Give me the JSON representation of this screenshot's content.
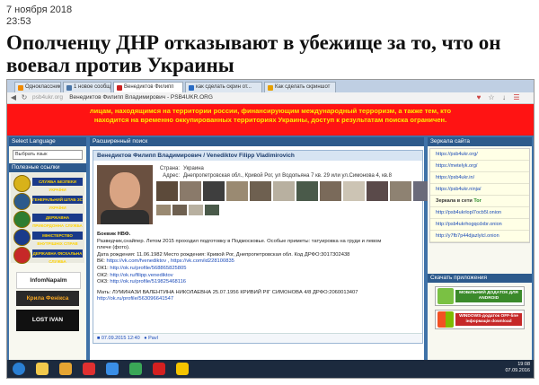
{
  "article": {
    "date": "7 ноября 2018",
    "time": "23:53",
    "headline": "Ополченцу ДНР отказывают в убежище за то, что он воевал против Украины"
  },
  "browser": {
    "tabs": [
      {
        "label": "Одноклассники",
        "color": "#f08a00"
      },
      {
        "label": "1 новое сообщение",
        "color": "#4a76a8"
      },
      {
        "label": "Венедиктов Филипп",
        "color": "#cc2222"
      },
      {
        "label": "как сделать скрин от...",
        "color": "#2a6cc4"
      },
      {
        "label": "Как сделать скриншот",
        "color": "#e6a000"
      }
    ],
    "url_host": "psb4ukr.org",
    "url_title": "Венедиктов Филипп Владимирович - PSB4UKR.ORG"
  },
  "banner": {
    "line1": "лицам, находящимся на территории россии, финансирующим международный терроризм, а также тем, кто",
    "line2": "находится на временно оккупированных территориях Украины, доступ к результатам поиска ограничен."
  },
  "left_panel": {
    "lang_title": "Select Language",
    "lang_select": "Выбрать язык",
    "links_title": "Полезные ссылки",
    "logo_lines": [
      "СЛУЖБА БЕЗПЕКИ УКРАЇНИ",
      "ГЕНЕРАЛЬНИЙ ШТАБ ЗС УКРАЇНИ",
      "ДЕРЖАВНА ПРИКОРДОННА СЛУЖБА",
      "МІНІСТЕРСТВО ВНУТРІШНІХ СПРАВ",
      "ДЕРЖАВНА ФІСКАЛЬНА СЛУЖБА"
    ],
    "bottom_links": [
      "InfomNapalm",
      "Крила Фенікса",
      "LOST IVAN"
    ]
  },
  "main_panel": {
    "section_title": "Расширенный поиск",
    "card_title": "Венедиктов Филипп Владимирович / Venediktov Filipp Vladimirovich",
    "country_label": "Страна:",
    "country": "Украина",
    "address_label": "Адрес:",
    "address": "Днепропетровская обл., Кривой Рог, ул Водопьяна 7 кв. 29 или ул.Симонова 4, кв.8",
    "bio_lines": [
      "Боевик НВФ.",
      "Разведчик,снайпер. Летом 2015 проходил подготовку в Подмосковье. Особые приметы: татуировка на груди и левом",
      "плече (фото).",
      "Дата рождения: 11.06.1982 Место рождения: Кривой Рог, Днепропетровская обл. Код ДРФО:3017302438"
    ],
    "social_labels": [
      "ВК:",
      "ОК1:",
      "ОК2:",
      "ОК3:"
    ],
    "social_links": [
      "https://vk.com/fvenediktov , https://vk.com/id228100835",
      "http://ok.ru/profile/568865825805",
      "http://ok.ru/filipp.venediktov",
      "http://ok.ru/profile/519825468116"
    ],
    "mother_line": "Мать: ЛУМИНАЗИ ВАЛЕНТИНА НИКОЛАЕВНА 25.07.1956 КРИВИЙ РІГ СИМОНОВА 4/8 ДРФО:2060013407",
    "mother_link": "http://ok.ru/profile/563096641547",
    "footer_date": "07.09.2015 12:40",
    "footer_author": "Pavl"
  },
  "right_panel": {
    "mirrors_title": "Зеркала сайта",
    "mirrors": [
      "https://psb4ukr.org/",
      "https://metelyk.org/",
      "https://psb4ukr.in/",
      "https://psb4ukr.ninja/"
    ],
    "tor_prefix": "Зеркала в сети",
    "tor_word": "Tor",
    "tor_mirrors": [
      "http://psb4ukrlopl7ocb5l.onion",
      "http://psb4ukrhogqcdxbr.onion",
      "http://y7fb7p44djazlylcl.onion"
    ],
    "apps_title": "Скачать приложения",
    "app_android": "МОБІЛЬНИЙ ДОДАТОК ДЛЯ ANDROID",
    "app_windows": "WINDOWS-додаток OFF-line інформація download"
  },
  "taskbar": {
    "time": "19:08",
    "date": "07.09.2016"
  }
}
